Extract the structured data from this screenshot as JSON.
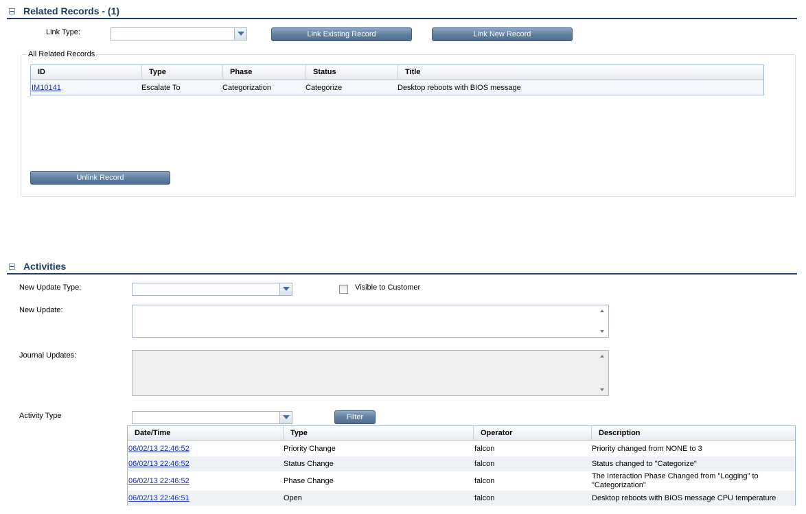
{
  "related_records": {
    "section_title": "Related Records - (1)",
    "link_type_label": "Link Type:",
    "link_type_value": "",
    "link_existing_label": "Link Existing Record",
    "link_new_label": "Link New Record",
    "group_label": "All Related Records",
    "columns": [
      "ID",
      "Type",
      "Phase",
      "Status",
      "Title"
    ],
    "rows": [
      {
        "id": "IM10141",
        "type": "Escalate To",
        "phase": "Categorization",
        "status": "Categorize",
        "title": "Desktop reboots with BIOS message"
      }
    ],
    "unlink_label": "Unlink Record"
  },
  "activities": {
    "section_title": "Activities",
    "new_update_type_label": "New Update Type:",
    "new_update_type_value": "",
    "visible_to_customer_label": "Visible to Customer",
    "visible_to_customer_checked": false,
    "new_update_label": "New Update:",
    "new_update_value": "",
    "journal_updates_label": "Journal Updates:",
    "journal_updates_value": "",
    "activity_type_label": "Activity Type",
    "activity_type_value": "",
    "filter_label": "Filter",
    "columns": [
      "Date/Time",
      "Type",
      "Operator",
      "Description"
    ],
    "rows": [
      {
        "datetime": "06/02/13 22:46:52",
        "type": "Priority Change",
        "operator": "falcon",
        "description": "Priority changed from NONE to 3"
      },
      {
        "datetime": "06/02/13 22:46:52",
        "type": "Status Change",
        "operator": "falcon",
        "description": "Status changed to \"Categorize\""
      },
      {
        "datetime": "06/02/13 22:46:52",
        "type": "Phase Change",
        "operator": "falcon",
        "description": "The Interaction Phase Changed from \"Logging\" to \"Categorization\""
      },
      {
        "datetime": "06/02/13 22:46:51",
        "type": "Open",
        "operator": "falcon",
        "description": "Desktop reboots with BIOS message CPU temperature"
      }
    ]
  },
  "colors": {
    "section_title": "#1f3b64",
    "button": "#5e7d9f",
    "link": "#1a2fb0",
    "row_alt": "#eef2f7"
  }
}
